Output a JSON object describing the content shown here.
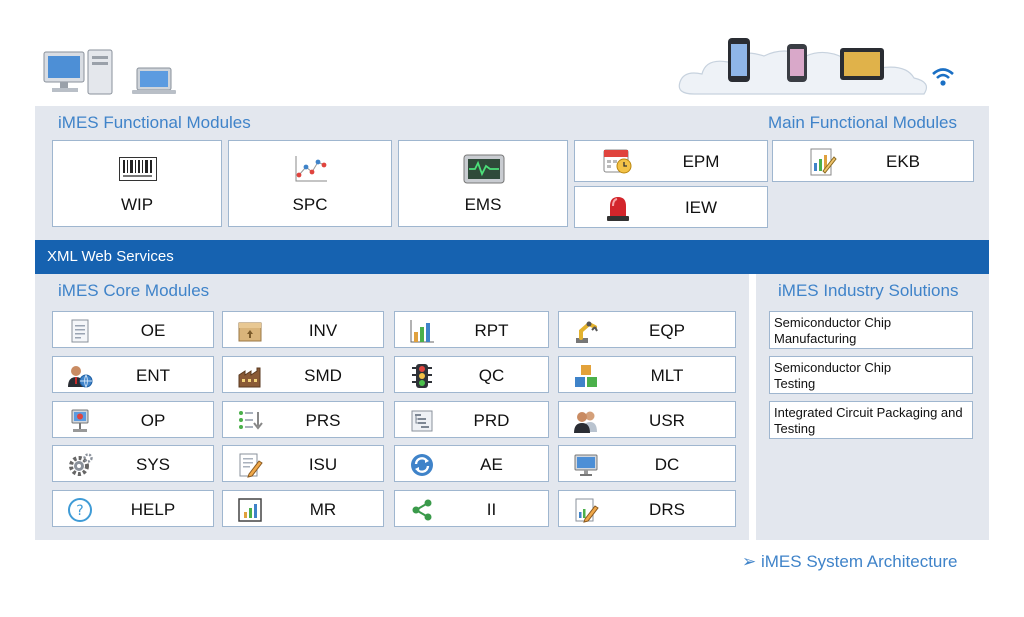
{
  "functional": {
    "title": "iMES Functional Modules",
    "main_title": "Main Functional Modules",
    "modules": [
      {
        "id": "wip",
        "label": "WIP",
        "icon": "barcode-icon"
      },
      {
        "id": "spc",
        "label": "SPC",
        "icon": "scatter-chart-icon"
      },
      {
        "id": "ems",
        "label": "EMS",
        "icon": "monitor-wave-icon"
      },
      {
        "id": "epm",
        "label": "EPM",
        "icon": "calendar-clock-icon"
      },
      {
        "id": "iew",
        "label": "IEW",
        "icon": "alarm-light-icon"
      },
      {
        "id": "ekb",
        "label": "EKB",
        "icon": "document-chart-icon"
      }
    ]
  },
  "xml_bar": {
    "label": "XML Web Services"
  },
  "core": {
    "title": "iMES Core Modules",
    "modules": [
      {
        "label": "OE",
        "icon": "document-icon"
      },
      {
        "label": "INV",
        "icon": "box-icon"
      },
      {
        "label": "RPT",
        "icon": "bar-chart-icon"
      },
      {
        "label": "EQP",
        "icon": "robot-arm-icon"
      },
      {
        "label": "ENT",
        "icon": "user-globe-icon"
      },
      {
        "label": "SMD",
        "icon": "factory-icon"
      },
      {
        "label": "QC",
        "icon": "traffic-light-icon"
      },
      {
        "label": "MLT",
        "icon": "blocks-icon"
      },
      {
        "label": "OP",
        "icon": "kiosk-icon"
      },
      {
        "label": "PRS",
        "icon": "process-list-icon"
      },
      {
        "label": "PRD",
        "icon": "product-tree-icon"
      },
      {
        "label": "USR",
        "icon": "users-icon"
      },
      {
        "label": "SYS",
        "icon": "gear-icon"
      },
      {
        "label": "ISU",
        "icon": "edit-document-icon"
      },
      {
        "label": "AE",
        "icon": "refresh-icon"
      },
      {
        "label": "DC",
        "icon": "monitor-icon"
      },
      {
        "label": "HELP",
        "icon": "help-icon"
      },
      {
        "label": "MR",
        "icon": "report-chart-icon"
      },
      {
        "label": "II",
        "icon": "share-icon"
      },
      {
        "label": "DRS",
        "icon": "edit-document-icon"
      }
    ]
  },
  "industry": {
    "title": "iMES Industry Solutions",
    "solutions": [
      {
        "line1": "Semiconductor Chip",
        "line2": "Manufacturing"
      },
      {
        "line1": "Semiconductor Chip",
        "line2": "Testing"
      },
      {
        "line1": "Integrated Circuit Packaging and",
        "line2": "Testing"
      }
    ]
  },
  "footer": {
    "arrow": "➢",
    "caption": "iMES System Architecture"
  },
  "colors": {
    "accent": "#3f83c9",
    "bar": "#1662b0",
    "panel": "#e3e7ee",
    "border": "#9fb6cf"
  }
}
